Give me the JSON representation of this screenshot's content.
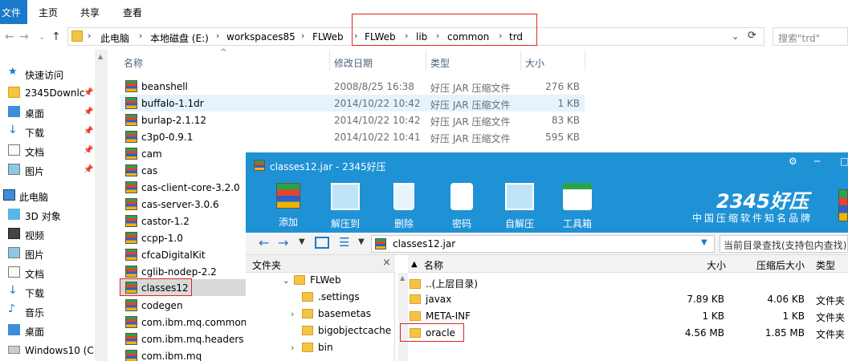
{
  "ribbon": {
    "file": "文件",
    "tabs": [
      "主页",
      "共享",
      "查看"
    ]
  },
  "address": {
    "crumbs": [
      "此电脑",
      "本地磁盘 (E:)",
      "workspaces85",
      "FLWeb",
      "FLWeb",
      "lib",
      "common",
      "trd"
    ],
    "search_placeholder": "搜索\"trd\""
  },
  "sidebar": {
    "items": [
      {
        "label": "快速访问",
        "icon": "star-icon",
        "pinned": false
      },
      {
        "label": "2345Downlc",
        "icon": "folder-icon",
        "pinned": true
      },
      {
        "label": "桌面",
        "icon": "desktop-icon",
        "pinned": true
      },
      {
        "label": "下载",
        "icon": "download-icon",
        "pinned": true
      },
      {
        "label": "文档",
        "icon": "document-icon",
        "pinned": true
      },
      {
        "label": "图片",
        "icon": "picture-icon",
        "pinned": true
      },
      {
        "label": "此电脑",
        "icon": "computer-icon",
        "pinned": false
      },
      {
        "label": "3D 对象",
        "icon": "cube-icon",
        "pinned": false
      },
      {
        "label": "视频",
        "icon": "video-icon",
        "pinned": false
      },
      {
        "label": "图片",
        "icon": "picture-icon",
        "pinned": false
      },
      {
        "label": "文档",
        "icon": "document-icon",
        "pinned": false
      },
      {
        "label": "下载",
        "icon": "download-icon",
        "pinned": false
      },
      {
        "label": "音乐",
        "icon": "music-icon",
        "pinned": false
      },
      {
        "label": "桌面",
        "icon": "desktop-icon",
        "pinned": false
      },
      {
        "label": "Windows10 (C:",
        "icon": "drive-icon",
        "pinned": false
      }
    ]
  },
  "list": {
    "headers": {
      "name": "名称",
      "date": "修改日期",
      "type": "类型",
      "size": "大小"
    },
    "rows": [
      {
        "name": "beanshell",
        "date": "2008/8/25 16:38",
        "type": "好压 JAR 压缩文件",
        "size": "276 KB"
      },
      {
        "name": "buffalo-1.1dr",
        "date": "2014/10/22 10:42",
        "type": "好压 JAR 压缩文件",
        "size": "1 KB"
      },
      {
        "name": "burlap-2.1.12",
        "date": "2014/10/22 10:42",
        "type": "好压 JAR 压缩文件",
        "size": "83 KB"
      },
      {
        "name": "c3p0-0.9.1",
        "date": "2014/10/22 10:41",
        "type": "好压 JAR 压缩文件",
        "size": "595 KB"
      },
      {
        "name": "cam",
        "date": "",
        "type": "",
        "size": ""
      },
      {
        "name": "cas",
        "date": "",
        "type": "",
        "size": ""
      },
      {
        "name": "cas-client-core-3.2.0",
        "date": "",
        "type": "",
        "size": ""
      },
      {
        "name": "cas-server-3.0.6",
        "date": "",
        "type": "",
        "size": ""
      },
      {
        "name": "castor-1.2",
        "date": "",
        "type": "",
        "size": ""
      },
      {
        "name": "ccpp-1.0",
        "date": "",
        "type": "",
        "size": ""
      },
      {
        "name": "cfcaDigitalKit",
        "date": "",
        "type": "",
        "size": ""
      },
      {
        "name": "cglib-nodep-2.2",
        "date": "",
        "type": "",
        "size": ""
      },
      {
        "name": "classes12",
        "date": "",
        "type": "",
        "size": ""
      },
      {
        "name": "codegen",
        "date": "",
        "type": "",
        "size": ""
      },
      {
        "name": "com.ibm.mq.commons",
        "date": "",
        "type": "",
        "size": ""
      },
      {
        "name": "com.ibm.mq.headers",
        "date": "",
        "type": "",
        "size": ""
      },
      {
        "name": "com.ibm.mq",
        "date": "",
        "type": "",
        "size": ""
      }
    ]
  },
  "haozip": {
    "title": "classes12.jar - 2345好压",
    "tools": [
      "添加",
      "解压到",
      "删除",
      "密码",
      "自解压",
      "工具箱"
    ],
    "brand": "2345好压",
    "slogan": "中国压缩软件知名品牌",
    "path": "classes12.jar",
    "search_placeholder": "当前目录查找(支持包内查找)",
    "tree_header": "文件夹",
    "tree": [
      {
        "label": "FLWeb",
        "level": 0,
        "expand": "v"
      },
      {
        "label": ".settings",
        "level": 1,
        "expand": ""
      },
      {
        "label": "basemetas",
        "level": 1,
        "expand": ">"
      },
      {
        "label": "bigobjectcache",
        "level": 1,
        "expand": ""
      },
      {
        "label": "bin",
        "level": 1,
        "expand": ">"
      }
    ],
    "headers": {
      "name": "名称",
      "size": "大小",
      "csize": "压缩后大小",
      "type": "类型"
    },
    "rows": [
      {
        "name": "..(上层目录)",
        "size": "",
        "csize": "",
        "type": ""
      },
      {
        "name": "javax",
        "size": "7.89 KB",
        "csize": "4.06 KB",
        "type": "文件夹"
      },
      {
        "name": "META-INF",
        "size": "1 KB",
        "csize": "1 KB",
        "type": "文件夹"
      },
      {
        "name": "oracle",
        "size": "4.56 MB",
        "csize": "1.85 MB",
        "type": "文件夹"
      }
    ]
  },
  "colors": {
    "accent": "#1f92d6",
    "highlight": "#e02525",
    "file_tab": "#1979ca"
  }
}
